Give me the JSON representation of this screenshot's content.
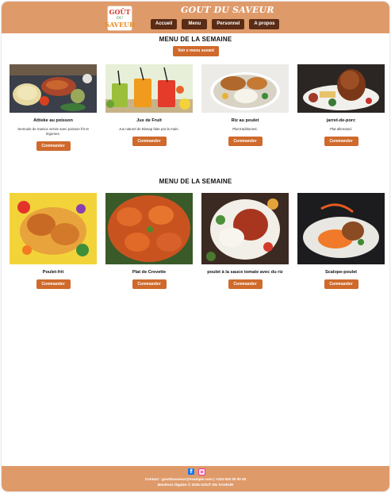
{
  "header": {
    "logo_lines": [
      "GOÛT",
      "DU",
      "SAVEUR"
    ],
    "title": "GOUT DU SAVEUR",
    "nav": [
      "Accueil",
      "Menu",
      "Personnel",
      "A propos"
    ]
  },
  "sections": [
    {
      "title": "MENU DE LA SEMAINE",
      "cta": "Voir e menu suvant",
      "items": [
        {
          "name": "Attieke au poisson",
          "desc": "Semoule de manioc servie avec poisson frit et légumes.",
          "button": "Commander"
        },
        {
          "name": "Jus de Fruit",
          "desc": "Jus naturel de Bissap faite par la main.",
          "button": "Commander"
        },
        {
          "name": "Riz au poulet",
          "desc": "Plat traditionnel.",
          "button": "Commander"
        },
        {
          "name": "jarret-de-porc",
          "desc": "Plat allemand.",
          "button": "Commander"
        }
      ]
    },
    {
      "title": "MENU DE LA SEMAINE",
      "items": [
        {
          "name": "Poulet-frit",
          "button": "Commander"
        },
        {
          "name": "Plat de Crevette",
          "button": "Commander"
        },
        {
          "name": "poulet à la sauce tomate avec du riz",
          "button": "Commander"
        },
        {
          "name": "Scalope-poulet",
          "button": "Commander"
        }
      ]
    }
  ],
  "footer": {
    "social": [
      "facebook-icon",
      "instagram-icon"
    ],
    "contact": "Contact : goutdusaveur@example.com | +224 620 00 00 00",
    "legal": "Mentions légales © 2025 GOUT DU SAVEUR"
  }
}
